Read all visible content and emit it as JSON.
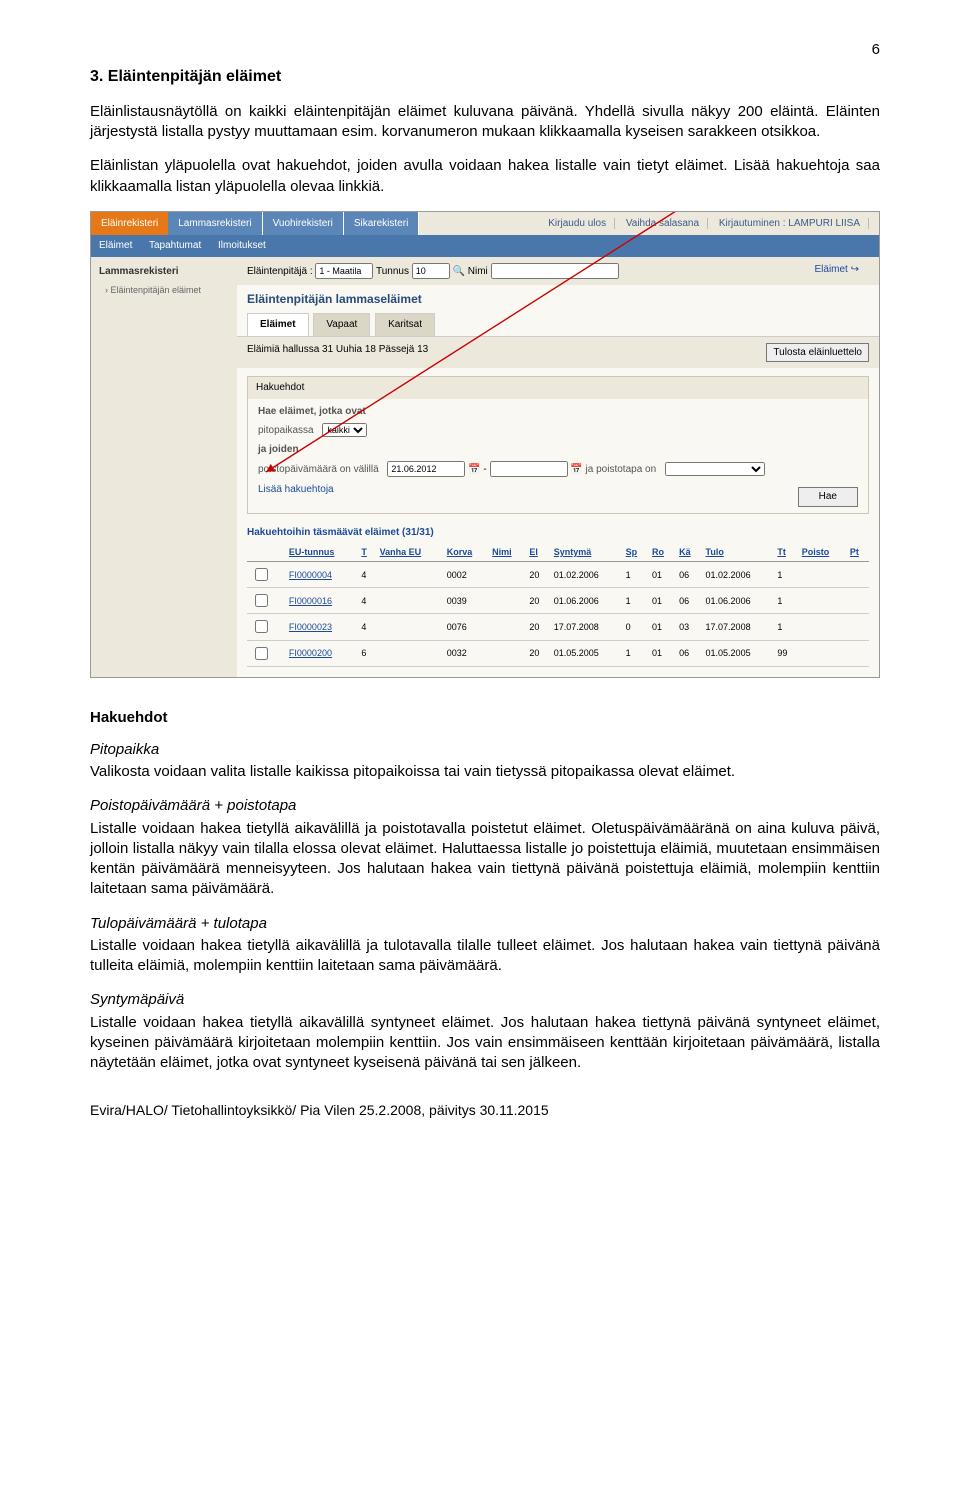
{
  "page_number": "6",
  "heading": "3. Eläintenpitäjän eläimet",
  "intro_p1": "Eläinlistausnäytöllä on kaikki eläintenpitäjän eläimet kuluvana päivänä. Yhdellä sivulla näkyy 200 eläintä. Eläinten järjestystä listalla pystyy muuttamaan esim. korvanumeron mukaan klikkaamalla kyseisen sarakkeen otsikkoa.",
  "intro_p2": "Eläinlistan yläpuolella ovat hakuehdot, joiden avulla voidaan hakea listalle vain tietyt eläimet. Lisää hakuehtoja saa klikkaamalla listan yläpuolella olevaa linkkiä.",
  "screenshot": {
    "top_tabs": [
      "Eläinrekisteri",
      "Lammasrekisteri",
      "Vuohirekisteri",
      "Sikarekisteri"
    ],
    "top_right": [
      "Kirjaudu ulos",
      "Vaihda salasana",
      "Kirjautuminen : LAMPURI LIISA"
    ],
    "subnav": [
      "Eläimet",
      "Tapahtumat",
      "Ilmoitukset"
    ],
    "side_title": "Lammasrekisteri",
    "side_item": "› Eläintenpitäjän eläimet",
    "filter_label1": "Eläintenpitäjä :",
    "filter_val1": "1 - Maatila",
    "filter_label2": "Tunnus",
    "filter_val2": "10",
    "filter_label3": "Nimi",
    "filter_link": "Eläimet ↪",
    "main_title": "Eläintenpitäjän lammaseläimet",
    "sub_tabs": [
      "Eläimet",
      "Vapaat",
      "Karitsat"
    ],
    "counts": "Eläimiä hallussa 31  Uuhia 18  Pässejä 13",
    "print_btn": "Tulosta eläinluettelo",
    "panel_head": "Hakuehdot",
    "hae_label": "Hae eläimet, jotka ovat",
    "pitopaikka_lbl": "pitopaikassa",
    "pitopaikka_val": "kaikki",
    "ja_joiden": "ja joiden",
    "poisto_lbl": "poistopäivämäärä on välillä",
    "date1": "21.06.2012",
    "ja_poistotapa": "ja poistotapa on",
    "lisaa_link": "Lisää hakuehtoja",
    "hae_btn": "Hae",
    "results_head": "Hakuehtoihin täsmäävät eläimet (31/31)",
    "columns": [
      "",
      "EU-tunnus",
      "T",
      "Vanha EU",
      "Korva",
      "Nimi",
      "El",
      "Syntymä",
      "Sp",
      "Ro",
      "Kä",
      "Tulo",
      "Tt",
      "Poisto",
      "Pt"
    ],
    "rows": [
      [
        "",
        "FI0000004",
        "4",
        "",
        "0002",
        "",
        "20",
        "01.02.2006",
        "1",
        "01",
        "06",
        "01.02.2006",
        "1",
        "",
        ""
      ],
      [
        "",
        "FI0000016",
        "4",
        "",
        "0039",
        "",
        "20",
        "01.06.2006",
        "1",
        "01",
        "06",
        "01.06.2006",
        "1",
        "",
        ""
      ],
      [
        "",
        "FI0000023",
        "4",
        "",
        "0076",
        "",
        "20",
        "17.07.2008",
        "0",
        "01",
        "03",
        "17.07.2008",
        "1",
        "",
        ""
      ],
      [
        "",
        "FI0000200",
        "6",
        "",
        "0032",
        "",
        "20",
        "01.05.2005",
        "1",
        "01",
        "06",
        "01.05.2005",
        "99",
        "",
        ""
      ]
    ]
  },
  "sec_hakuehdot": "Hakuehdot",
  "pitopaikka_h": "Pitopaikka",
  "pitopaikka_p": "Valikosta voidaan valita listalle kaikissa pitopaikoissa tai vain tietyssä pitopaikassa olevat eläimet.",
  "poistop_h": "Poistopäivämäärä + poistotapa",
  "poistop_p": "Listalle voidaan hakea tietyllä aikavälillä ja poistotavalla poistetut eläimet. Oletuspäivämääränä on aina kuluva päivä, jolloin listalla näkyy vain tilalla elossa olevat eläimet. Haluttaessa listalle jo poistettuja eläimiä, muutetaan ensimmäisen kentän päivämäärä menneisyyteen. Jos halutaan hakea vain tiettynä päivänä poistettuja eläimiä, molempiin kenttiin laitetaan sama päivämäärä.",
  "tulop_h": "Tulopäivämäärä + tulotapa",
  "tulop_p": "Listalle voidaan hakea tietyllä aikavälillä ja tulotavalla tilalle tulleet eläimet. Jos halutaan hakea vain tiettynä päivänä tulleita eläimiä, molempiin kenttiin laitetaan sama päivämäärä.",
  "synt_h": "Syntymäpäivä",
  "synt_p": "Listalle voidaan hakea tietyllä aikavälillä syntyneet eläimet. Jos halutaan hakea tiettynä päivänä syntyneet eläimet, kyseinen päivämäärä kirjoitetaan molempiin kenttiin. Jos vain ensimmäiseen kenttään kirjoitetaan päivämäärä, listalla näytetään eläimet, jotka ovat syntyneet kyseisenä päivänä tai sen jälkeen.",
  "footer": "Evira/HALO/ Tietohallintoyksikkö/ Pia Vilen 25.2.2008, päivitys 30.11.2015"
}
